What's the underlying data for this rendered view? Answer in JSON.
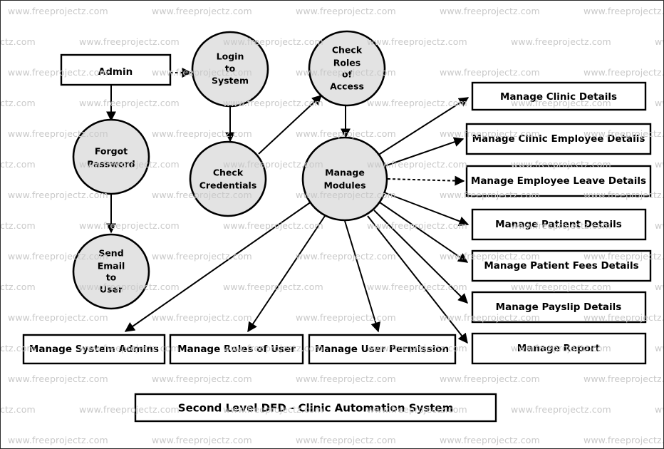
{
  "diagram": {
    "title": "Second Level DFD - Clinic Automation System",
    "watermark_text": "www.freeprojectz.com",
    "colors": {
      "process_fill": "#e3e3e3",
      "entity_fill": "#ffffff",
      "stroke": "#000000",
      "watermark": "#c9c9c9",
      "background": "#ffffff"
    },
    "external_entities": [
      {
        "id": "admin",
        "label": "Admin"
      }
    ],
    "processes": [
      {
        "id": "login",
        "label_lines": [
          "Login",
          "to",
          "System"
        ]
      },
      {
        "id": "roles",
        "label_lines": [
          "Check",
          "Roles",
          "of",
          "Access"
        ]
      },
      {
        "id": "forgot",
        "label_lines": [
          "Forgot",
          "Password"
        ]
      },
      {
        "id": "credentials",
        "label_lines": [
          "Check",
          "Credentials"
        ]
      },
      {
        "id": "sendemail",
        "label_lines": [
          "Send",
          "Email",
          "to",
          "User"
        ]
      },
      {
        "id": "modules",
        "label_lines": [
          "Manage",
          "Modules"
        ]
      }
    ],
    "data_stores_right": [
      {
        "id": "clinic",
        "label": "Manage Clinic Details"
      },
      {
        "id": "clinic_emp",
        "label": "Manage Clinic Employee Details"
      },
      {
        "id": "emp_leave",
        "label": "Manage Employee Leave Details"
      },
      {
        "id": "patient",
        "label": "Manage Patient Details"
      },
      {
        "id": "patient_fees",
        "label": "Manage Patient Fees Details"
      },
      {
        "id": "payslip",
        "label": "Manage Payslip Details"
      },
      {
        "id": "report",
        "label": "Manage Report"
      }
    ],
    "data_stores_bottom": [
      {
        "id": "sys_admins",
        "label": "Manage System Admins"
      },
      {
        "id": "roles_of_user",
        "label": "Manage Roles of User"
      },
      {
        "id": "user_permission",
        "label": "Manage User Permission"
      }
    ],
    "flows": [
      {
        "from": "admin",
        "to": "login",
        "style": "dashed"
      },
      {
        "from": "admin",
        "to": "forgot",
        "style": "solid"
      },
      {
        "from": "login",
        "to": "credentials",
        "style": "solid"
      },
      {
        "from": "credentials",
        "to": "roles",
        "style": "solid"
      },
      {
        "from": "roles",
        "to": "modules",
        "style": "solid"
      },
      {
        "from": "forgot",
        "to": "sendemail",
        "style": "solid"
      },
      {
        "from": "modules",
        "to": "clinic",
        "style": "solid"
      },
      {
        "from": "modules",
        "to": "clinic_emp",
        "style": "solid"
      },
      {
        "from": "modules",
        "to": "emp_leave",
        "style": "dashed"
      },
      {
        "from": "modules",
        "to": "patient",
        "style": "solid"
      },
      {
        "from": "modules",
        "to": "patient_fees",
        "style": "solid"
      },
      {
        "from": "modules",
        "to": "payslip",
        "style": "solid"
      },
      {
        "from": "modules",
        "to": "report",
        "style": "solid"
      },
      {
        "from": "modules",
        "to": "sys_admins",
        "style": "solid"
      },
      {
        "from": "modules",
        "to": "roles_of_user",
        "style": "solid"
      },
      {
        "from": "modules",
        "to": "user_permission",
        "style": "solid"
      }
    ]
  }
}
